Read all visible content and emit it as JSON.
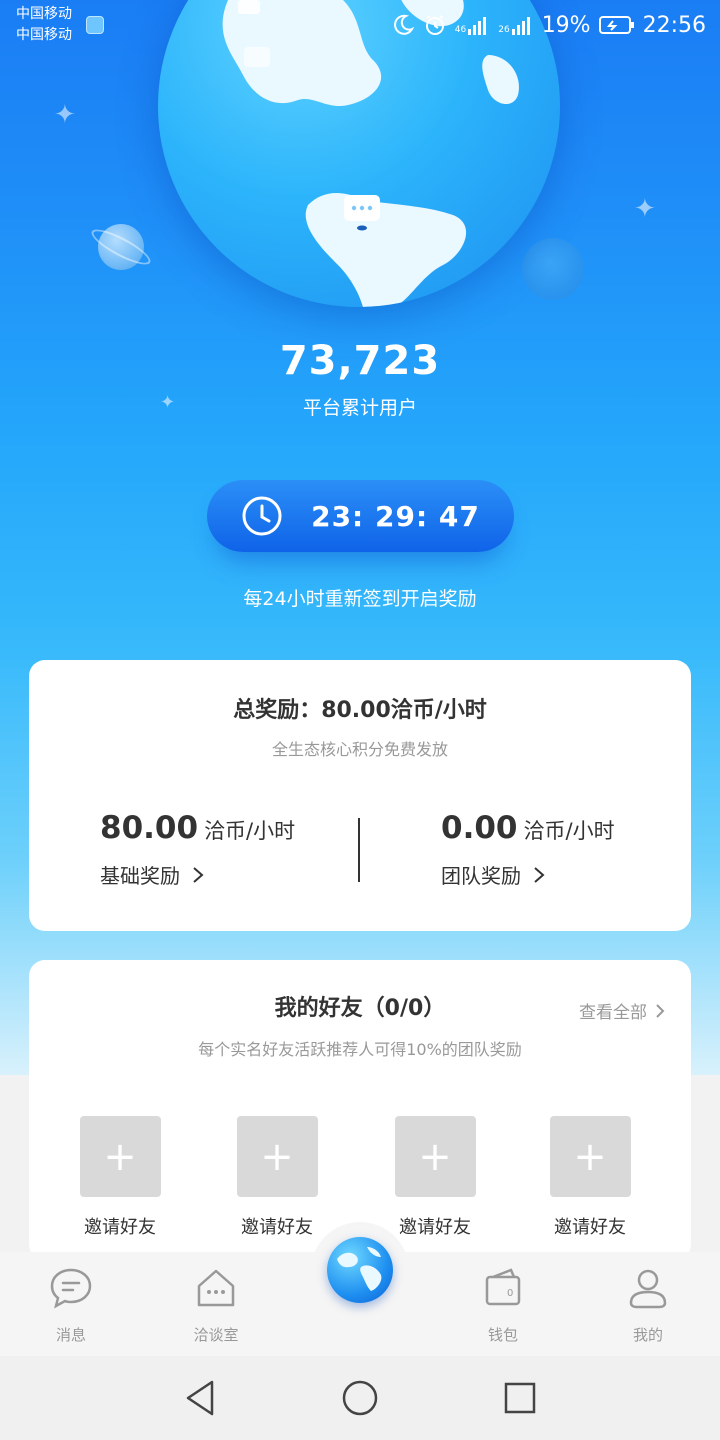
{
  "status_bar": {
    "carrier_1": "中国移动",
    "carrier_2": "中国移动",
    "net_1": "46",
    "net_2": "26",
    "battery": "19%",
    "time": "22:56"
  },
  "stats": {
    "users_count": "73,723",
    "users_label": "平台累计用户"
  },
  "timer": {
    "countdown": "23: 29: 47",
    "tip": "每24小时重新签到开启奖励"
  },
  "reward_card": {
    "title": "总奖励：80.00洽币/小时",
    "subtitle": "全生态核心积分免费发放",
    "basic": {
      "value": "80.00",
      "unit": "洽币/小时",
      "label": "基础奖励"
    },
    "team": {
      "value": "0.00",
      "unit": "洽币/小时",
      "label": "团队奖励"
    }
  },
  "friends_card": {
    "title": "我的好友（0/0）",
    "view_all": "查看全部",
    "subtitle": "每个实名好友活跃推荐人可得10%的团队奖励",
    "invite_label": "邀请好友",
    "invite_symbol": "+"
  },
  "tabs": {
    "messages": "消息",
    "chat_room": "洽谈室",
    "wallet": "钱包",
    "wallet_badge": "0",
    "me": "我的"
  },
  "colors": {
    "primary_blue": "#1a7df4",
    "button_blue": "#0f63e8",
    "text_dark": "#333333",
    "text_muted": "#999999",
    "placeholder_gray": "#d9d9d9"
  }
}
